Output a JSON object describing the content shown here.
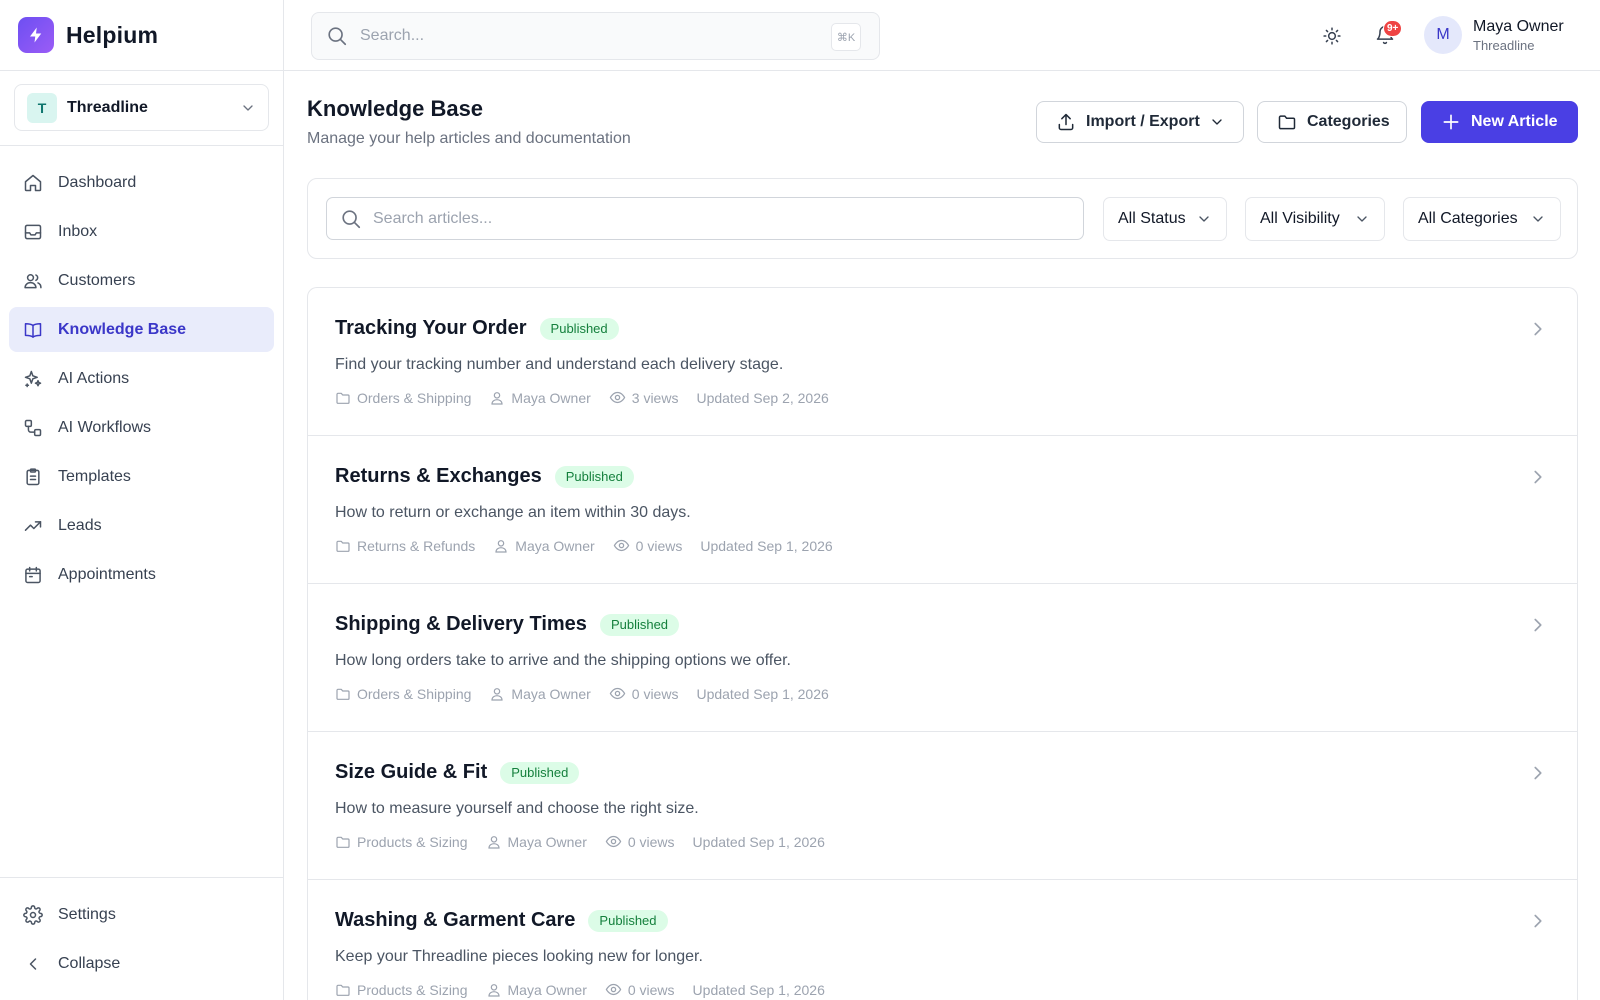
{
  "brand": {
    "name": "Helpium"
  },
  "org_switcher": {
    "initial": "T",
    "name": "Threadline"
  },
  "nav": {
    "items": [
      {
        "label": "Dashboard",
        "icon": "home-icon"
      },
      {
        "label": "Inbox",
        "icon": "inbox-icon"
      },
      {
        "label": "Customers",
        "icon": "users-icon"
      },
      {
        "label": "Knowledge Base",
        "icon": "book-icon",
        "active": true
      },
      {
        "label": "AI Actions",
        "icon": "sparkles-icon"
      },
      {
        "label": "AI Workflows",
        "icon": "workflow-icon"
      },
      {
        "label": "Templates",
        "icon": "clipboard-icon"
      },
      {
        "label": "Leads",
        "icon": "trending-up-icon"
      },
      {
        "label": "Appointments",
        "icon": "calendar-icon"
      }
    ],
    "settings_label": "Settings",
    "collapse_label": "Collapse"
  },
  "topbar": {
    "search_placeholder": "Search...",
    "shortcut": "⌘K",
    "notification_count": "9+",
    "user": {
      "initial": "M",
      "name": "Maya Owner",
      "org": "Threadline"
    }
  },
  "page": {
    "title": "Knowledge Base",
    "subtitle": "Manage your help articles and documentation",
    "import_export_label": "Import / Export",
    "categories_label": "Categories",
    "new_article_label": "New Article"
  },
  "filters": {
    "search_placeholder": "Search articles...",
    "status": "All Status",
    "visibility": "All Visibility",
    "categories": "All Categories"
  },
  "articles": [
    {
      "title": "Tracking Your Order",
      "status": "Published",
      "description": "Find your tracking number and understand each delivery stage.",
      "category": "Orders & Shipping",
      "author": "Maya Owner",
      "views": "3 views",
      "updated": "Updated Sep 2, 2026"
    },
    {
      "title": "Returns & Exchanges",
      "status": "Published",
      "description": "How to return or exchange an item within 30 days.",
      "category": "Returns & Refunds",
      "author": "Maya Owner",
      "views": "0 views",
      "updated": "Updated Sep 1, 2026"
    },
    {
      "title": "Shipping & Delivery Times",
      "status": "Published",
      "description": "How long orders take to arrive and the shipping options we offer.",
      "category": "Orders & Shipping",
      "author": "Maya Owner",
      "views": "0 views",
      "updated": "Updated Sep 1, 2026"
    },
    {
      "title": "Size Guide & Fit",
      "status": "Published",
      "description": "How to measure yourself and choose the right size.",
      "category": "Products & Sizing",
      "author": "Maya Owner",
      "views": "0 views",
      "updated": "Updated Sep 1, 2026"
    },
    {
      "title": "Washing & Garment Care",
      "status": "Published",
      "description": "Keep your Threadline pieces looking new for longer.",
      "category": "Products & Sizing",
      "author": "Maya Owner",
      "views": "0 views",
      "updated": "Updated Sep 1, 2026"
    }
  ],
  "colors": {
    "accent": "#4a3fe4",
    "active_nav_bg": "#e9ecfb",
    "published_bg": "#dcfce7",
    "published_text": "#15803d",
    "notification_badge": "#ef4444"
  }
}
